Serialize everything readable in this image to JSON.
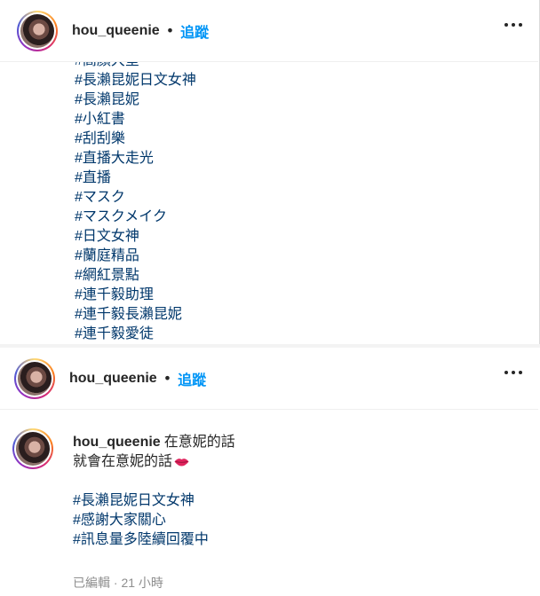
{
  "top_post": {
    "username": "hou_queenie",
    "separator": "•",
    "follow_label": "追蹤",
    "partial_tag": "#高顏大堂",
    "hashtags": [
      "#長瀨昆妮日文女神",
      "#長瀨昆妮",
      "#小紅書",
      "#刮刮樂",
      "#直播大走光",
      "#直播",
      "#マスク",
      "#マスクメイク",
      "#日文女神",
      "#蘭庭精品",
      "#網紅景點",
      "#連千毅助理",
      "#連千毅長瀨昆妮",
      "#連千毅愛徒"
    ]
  },
  "bottom_post": {
    "username": "hou_queenie",
    "separator": "•",
    "follow_label": "追蹤",
    "comment": {
      "username": "hou_queenie",
      "line1": "在意妮的話",
      "line2": "就會在意妮的話",
      "emoji": "lips-icon",
      "hashtags": [
        "#長瀨昆妮日文女神",
        "#感謝大家關心",
        "#訊息量多陸續回覆中"
      ]
    },
    "meta": "已編輯 · 21 小時"
  },
  "colors": {
    "link": "#00376b",
    "follow": "#0095f6",
    "text": "#262626",
    "muted": "#8e8e8e"
  }
}
